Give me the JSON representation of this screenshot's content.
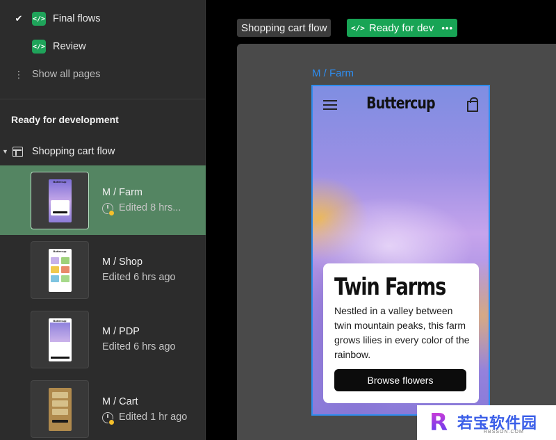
{
  "sidebar": {
    "pages": [
      {
        "label": "Final flows",
        "checked": true
      },
      {
        "label": "Review",
        "checked": false
      }
    ],
    "show_all_label": "Show all pages",
    "section_title": "Ready for development",
    "flow": {
      "label": "Shopping cart flow"
    },
    "frames": [
      {
        "name": "M / Farm",
        "edited": "Edited 8 hrs...",
        "recent": true,
        "selected": true,
        "thumb_title": "Buttercup",
        "thumb_heading": "Twin Farms"
      },
      {
        "name": "M / Shop",
        "edited": "Edited 6 hrs ago",
        "recent": false,
        "selected": false,
        "thumb_title": "Buttercup"
      },
      {
        "name": "M / PDP",
        "edited": "Edited 6 hrs ago",
        "recent": false,
        "selected": false,
        "thumb_title": "Buttercup"
      },
      {
        "name": "M / Cart",
        "edited": "Edited 1 hr ago",
        "recent": true,
        "selected": false
      }
    ]
  },
  "canvas": {
    "flow_tag": "Shopping cart flow",
    "dev_tag": {
      "code": "</>",
      "label": "Ready for dev",
      "more": "•••"
    },
    "frame_label": "M / Farm",
    "phone": {
      "brand": "Buttercup",
      "card_title": "Twin Farms",
      "card_body": "Nestled in a valley between twin mountain peaks, this farm grows lilies in every color of the rainbow.",
      "button_label": "Browse flowers"
    }
  },
  "watermark": {
    "text": "若宝软件园",
    "sub": "RBSSON.COM"
  },
  "colors": {
    "sidebar_bg": "#2c2c2c",
    "selected_bg": "#548562",
    "dev_green": "#18a455",
    "frame_blue": "#2f8ded",
    "recent_dot": "#f5c02b"
  },
  "icons": [
    "check-icon",
    "code-icon",
    "more-dots-icon",
    "caret-down-icon",
    "frame-icon",
    "history-icon",
    "hamburger-menu-icon",
    "shopping-bag-icon"
  ]
}
